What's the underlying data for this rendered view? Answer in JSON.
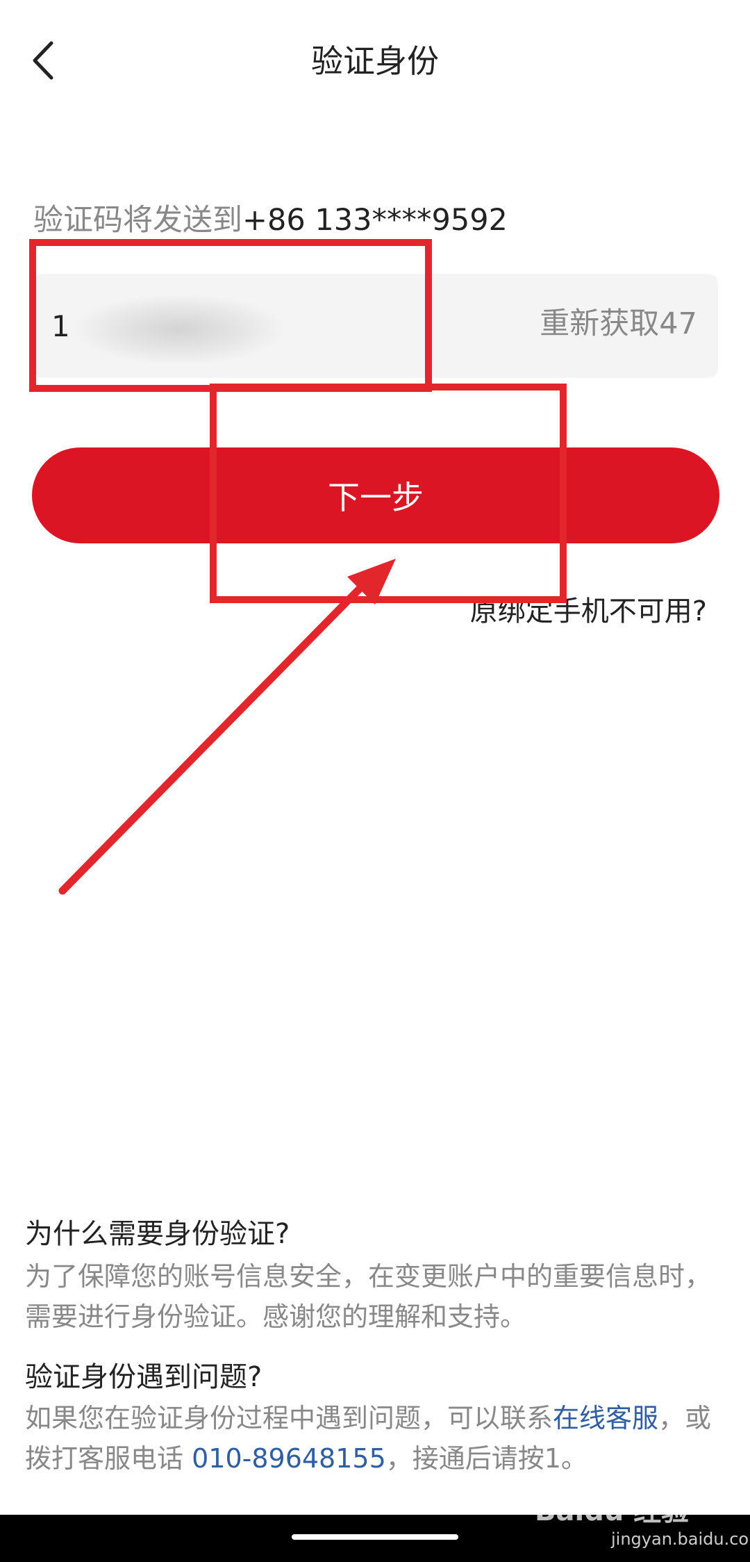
{
  "header": {
    "back_icon": "chevron-left-icon",
    "title": "验证身份"
  },
  "send_info": {
    "prefix": "验证码将发送到",
    "phone": "+86 133****9592"
  },
  "code_field": {
    "value": "1",
    "resend_label": "重新获取47"
  },
  "next_button": {
    "label": "下一步"
  },
  "phone_unavailable": "原绑定手机不可用?",
  "help": {
    "why_title": "为什么需要身份验证?",
    "why_body": "为了保障您的账号信息安全，在变更账户中的重要信息时，需要进行身份验证。感谢您的理解和支持。",
    "problem_title": "验证身份遇到问题?",
    "problem_body_1": "如果您在验证身份过程中遇到问题，可以联系",
    "online_service": "在线客服",
    "problem_body_2": "，或拨打客服电话 ",
    "hotline": "010-89648155",
    "problem_body_3": "，接通后请按1。"
  },
  "watermark": {
    "brand": "Baidu 经验",
    "site": "jingyan.baidu.com"
  },
  "colors": {
    "accent_red": "#dc1524",
    "annotation_red": "#e2262c",
    "link_blue": "#2f5ea3",
    "muted_text": "#888888"
  }
}
